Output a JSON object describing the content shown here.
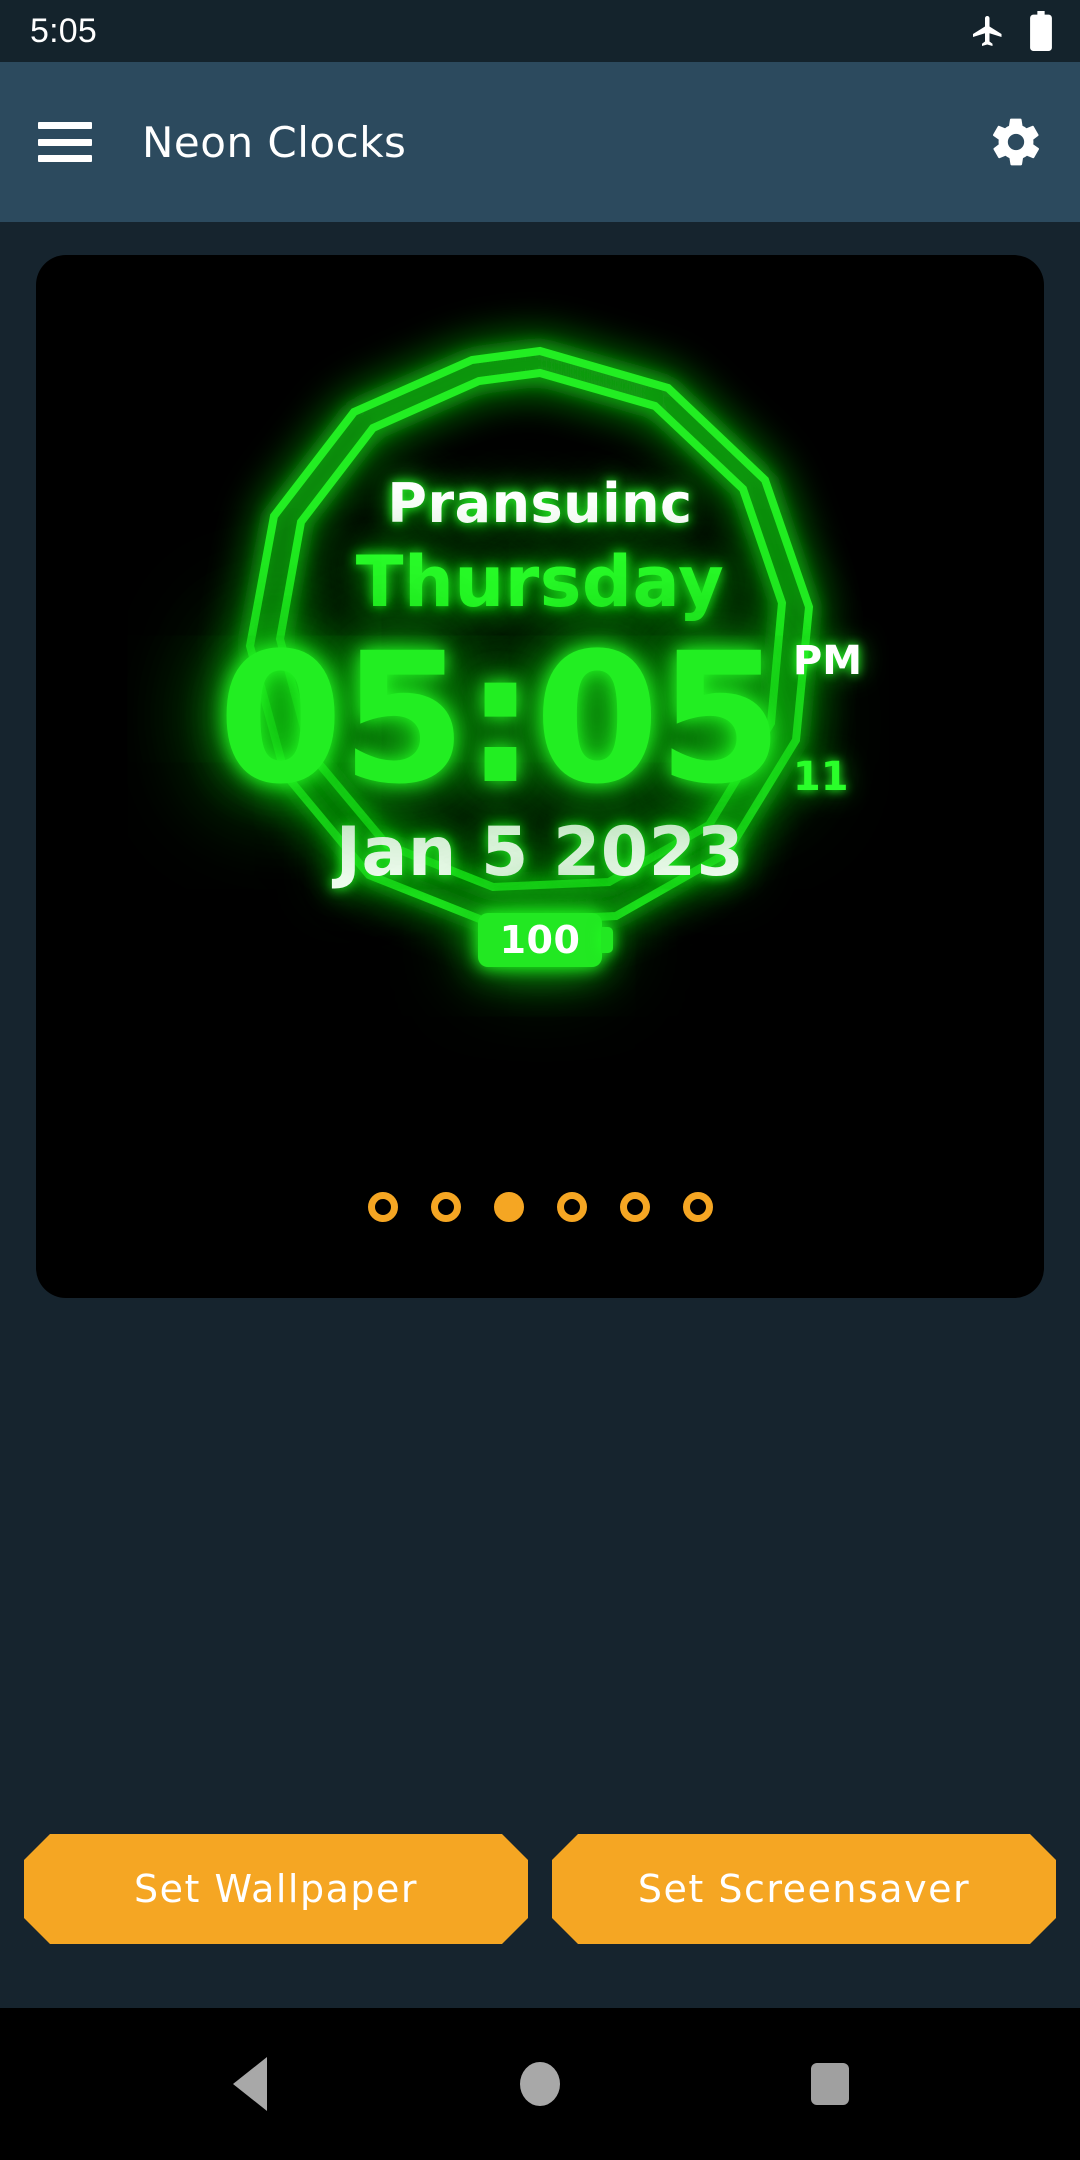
{
  "status_bar": {
    "time": "5:05",
    "icons": [
      "airplane-mode-icon",
      "battery-full-icon"
    ]
  },
  "app_bar": {
    "menu_icon": "hamburger-menu-icon",
    "title": "Neon Clocks",
    "settings_icon": "gear-icon"
  },
  "clock_preview": {
    "brand": "Pransuinc",
    "weekday": "Thursday",
    "time": "05:05",
    "ampm": "PM",
    "seconds": "11",
    "date": "Jan 5 2023",
    "battery": "100",
    "frame_shape": "double-line-neon-decagon",
    "colors": {
      "neon_green": "#22ee22",
      "neon_white": "#ffffff",
      "card_background": "#000000",
      "accent_orange": "#f5a623",
      "app_bar": "#2c4a5e",
      "page_background": "#16242e"
    }
  },
  "pager": {
    "total": 6,
    "active_index": 2
  },
  "actions": {
    "set_wallpaper": "Set Wallpaper",
    "set_screensaver": "Set Screensaver"
  },
  "navigation_bar": {
    "back": "back-icon",
    "home": "home-icon",
    "recents": "recents-icon"
  }
}
